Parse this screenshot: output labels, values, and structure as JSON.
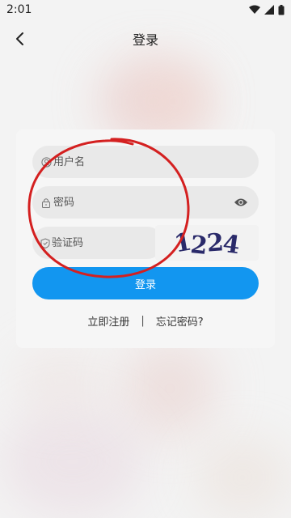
{
  "status_bar": {
    "time": "2:01",
    "icons": [
      "wifi-icon",
      "signal-icon",
      "battery-icon"
    ]
  },
  "nav": {
    "back_icon": "chevron-left-icon",
    "title": "登录"
  },
  "form": {
    "username": {
      "placeholder": "用户名",
      "value": "",
      "icon": "user-icon"
    },
    "password": {
      "placeholder": "密码",
      "value": "",
      "icon": "lock-icon",
      "toggle_icon": "eye-icon"
    },
    "captcha": {
      "placeholder": "验证码",
      "value": "",
      "icon": "shield-icon",
      "image_text": [
        "1",
        "2",
        "2",
        "4"
      ]
    },
    "login_label": "登录"
  },
  "links": {
    "register": "立即注册",
    "separator": "|",
    "forgot": "忘记密码?"
  },
  "colors": {
    "primary": "#1296f0",
    "annotation": "#d42020",
    "captcha_text": "#2a2a6a"
  }
}
